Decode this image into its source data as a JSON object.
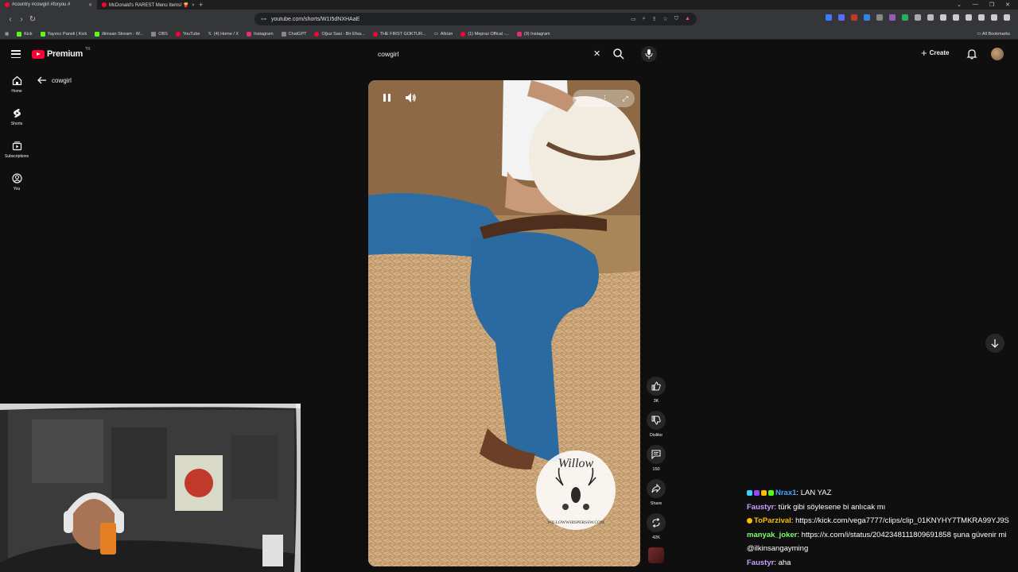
{
  "browser": {
    "tabs": [
      {
        "title": "#country #cowgirl #foryou #",
        "active": true
      },
      {
        "title": "McDonald's RAREST Menu Items! 🍟",
        "active": false
      }
    ],
    "url": "youtube.com/shorts/W1I5dNXHAaE",
    "bookmarks": [
      "Kick",
      "Yayıncı Paneli | Kick",
      "ilkinsan Stream - W...",
      "OBS",
      "YouTube",
      "(4) Home / X",
      "Instagram",
      "ChatGPT",
      "Oğuz Sasi - Bir Efsa...",
      "THE FIRST GOKTUR...",
      "Albüm",
      "(1) Mepraz Offical -...",
      "(9) Instagram"
    ],
    "all_bookmarks": "All Bookmarks"
  },
  "youtube": {
    "logo_text": "Premium",
    "logo_sup": "TR",
    "search_value": "cowgirl",
    "create_label": "Create",
    "nav": [
      {
        "label": "Home",
        "icon": "home-icon"
      },
      {
        "label": "Shorts",
        "icon": "shorts-icon"
      },
      {
        "label": "Subscriptions",
        "icon": "subscriptions-icon"
      },
      {
        "label": "You",
        "icon": "you-icon"
      }
    ],
    "back_label": "cowgirl"
  },
  "short": {
    "watermark_name": "Willow",
    "watermark_ring": "WILLOWWHISPERSSW.COM",
    "actions": [
      {
        "icon": "like-icon",
        "label": "3K"
      },
      {
        "icon": "dislike-icon",
        "label": "Dislike"
      },
      {
        "icon": "comment-icon",
        "label": "150"
      },
      {
        "icon": "share-icon",
        "label": "Share"
      },
      {
        "icon": "remix-icon",
        "label": "42K"
      }
    ]
  },
  "chat": [
    {
      "user": "Nrax1",
      "color": "#4aa3ff",
      "message": "LAN YAZ",
      "badges": [
        "#3ad0ff",
        "#9146ff",
        "#f6c000",
        "#53fc18"
      ]
    },
    {
      "user": "Faustyr",
      "color": "#c8a2ff",
      "message": "türk gibi söylesene bi anlıcak mı",
      "badges": []
    },
    {
      "user": "ToParzival",
      "color": "#f6c000",
      "message": "https://kick.com/vega7777/clips/clip_01KNYHY7TMKRA99YJ9S",
      "badges": [
        "#f6c000"
      ]
    },
    {
      "user": "manyak_joker",
      "color": "#7cff6b",
      "message": "https://x.com/i/status/2042348111809691858 şuna güvenir mi",
      "badges": []
    },
    {
      "user": "",
      "color": "#ffffff",
      "message": "@ilkinsangayming",
      "badges": []
    },
    {
      "user": "Faustyr",
      "color": "#c8a2ff",
      "message": "aha",
      "badges": []
    }
  ]
}
